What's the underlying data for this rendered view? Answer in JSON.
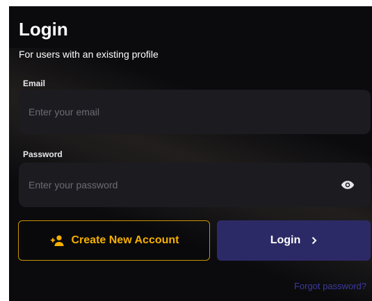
{
  "login": {
    "title": "Login",
    "subtitle": "For users with an existing profile",
    "email": {
      "label": "Email",
      "placeholder": "Enter your email",
      "value": ""
    },
    "password": {
      "label": "Password",
      "placeholder": "Enter your password",
      "value": "",
      "toggle_icon": "eye-icon"
    },
    "create_account_label": "Create New Account",
    "create_account_icon": "person-add-icon",
    "login_label": "Login",
    "login_icon": "chevron-right-icon",
    "forgot_password_label": "Forgot password?"
  },
  "colors": {
    "background": "#0b0b0e",
    "field": "#1b1b20",
    "accent_gold": "#f5b000",
    "login_button": "#2c2a66",
    "link": "#3c3aa0"
  }
}
